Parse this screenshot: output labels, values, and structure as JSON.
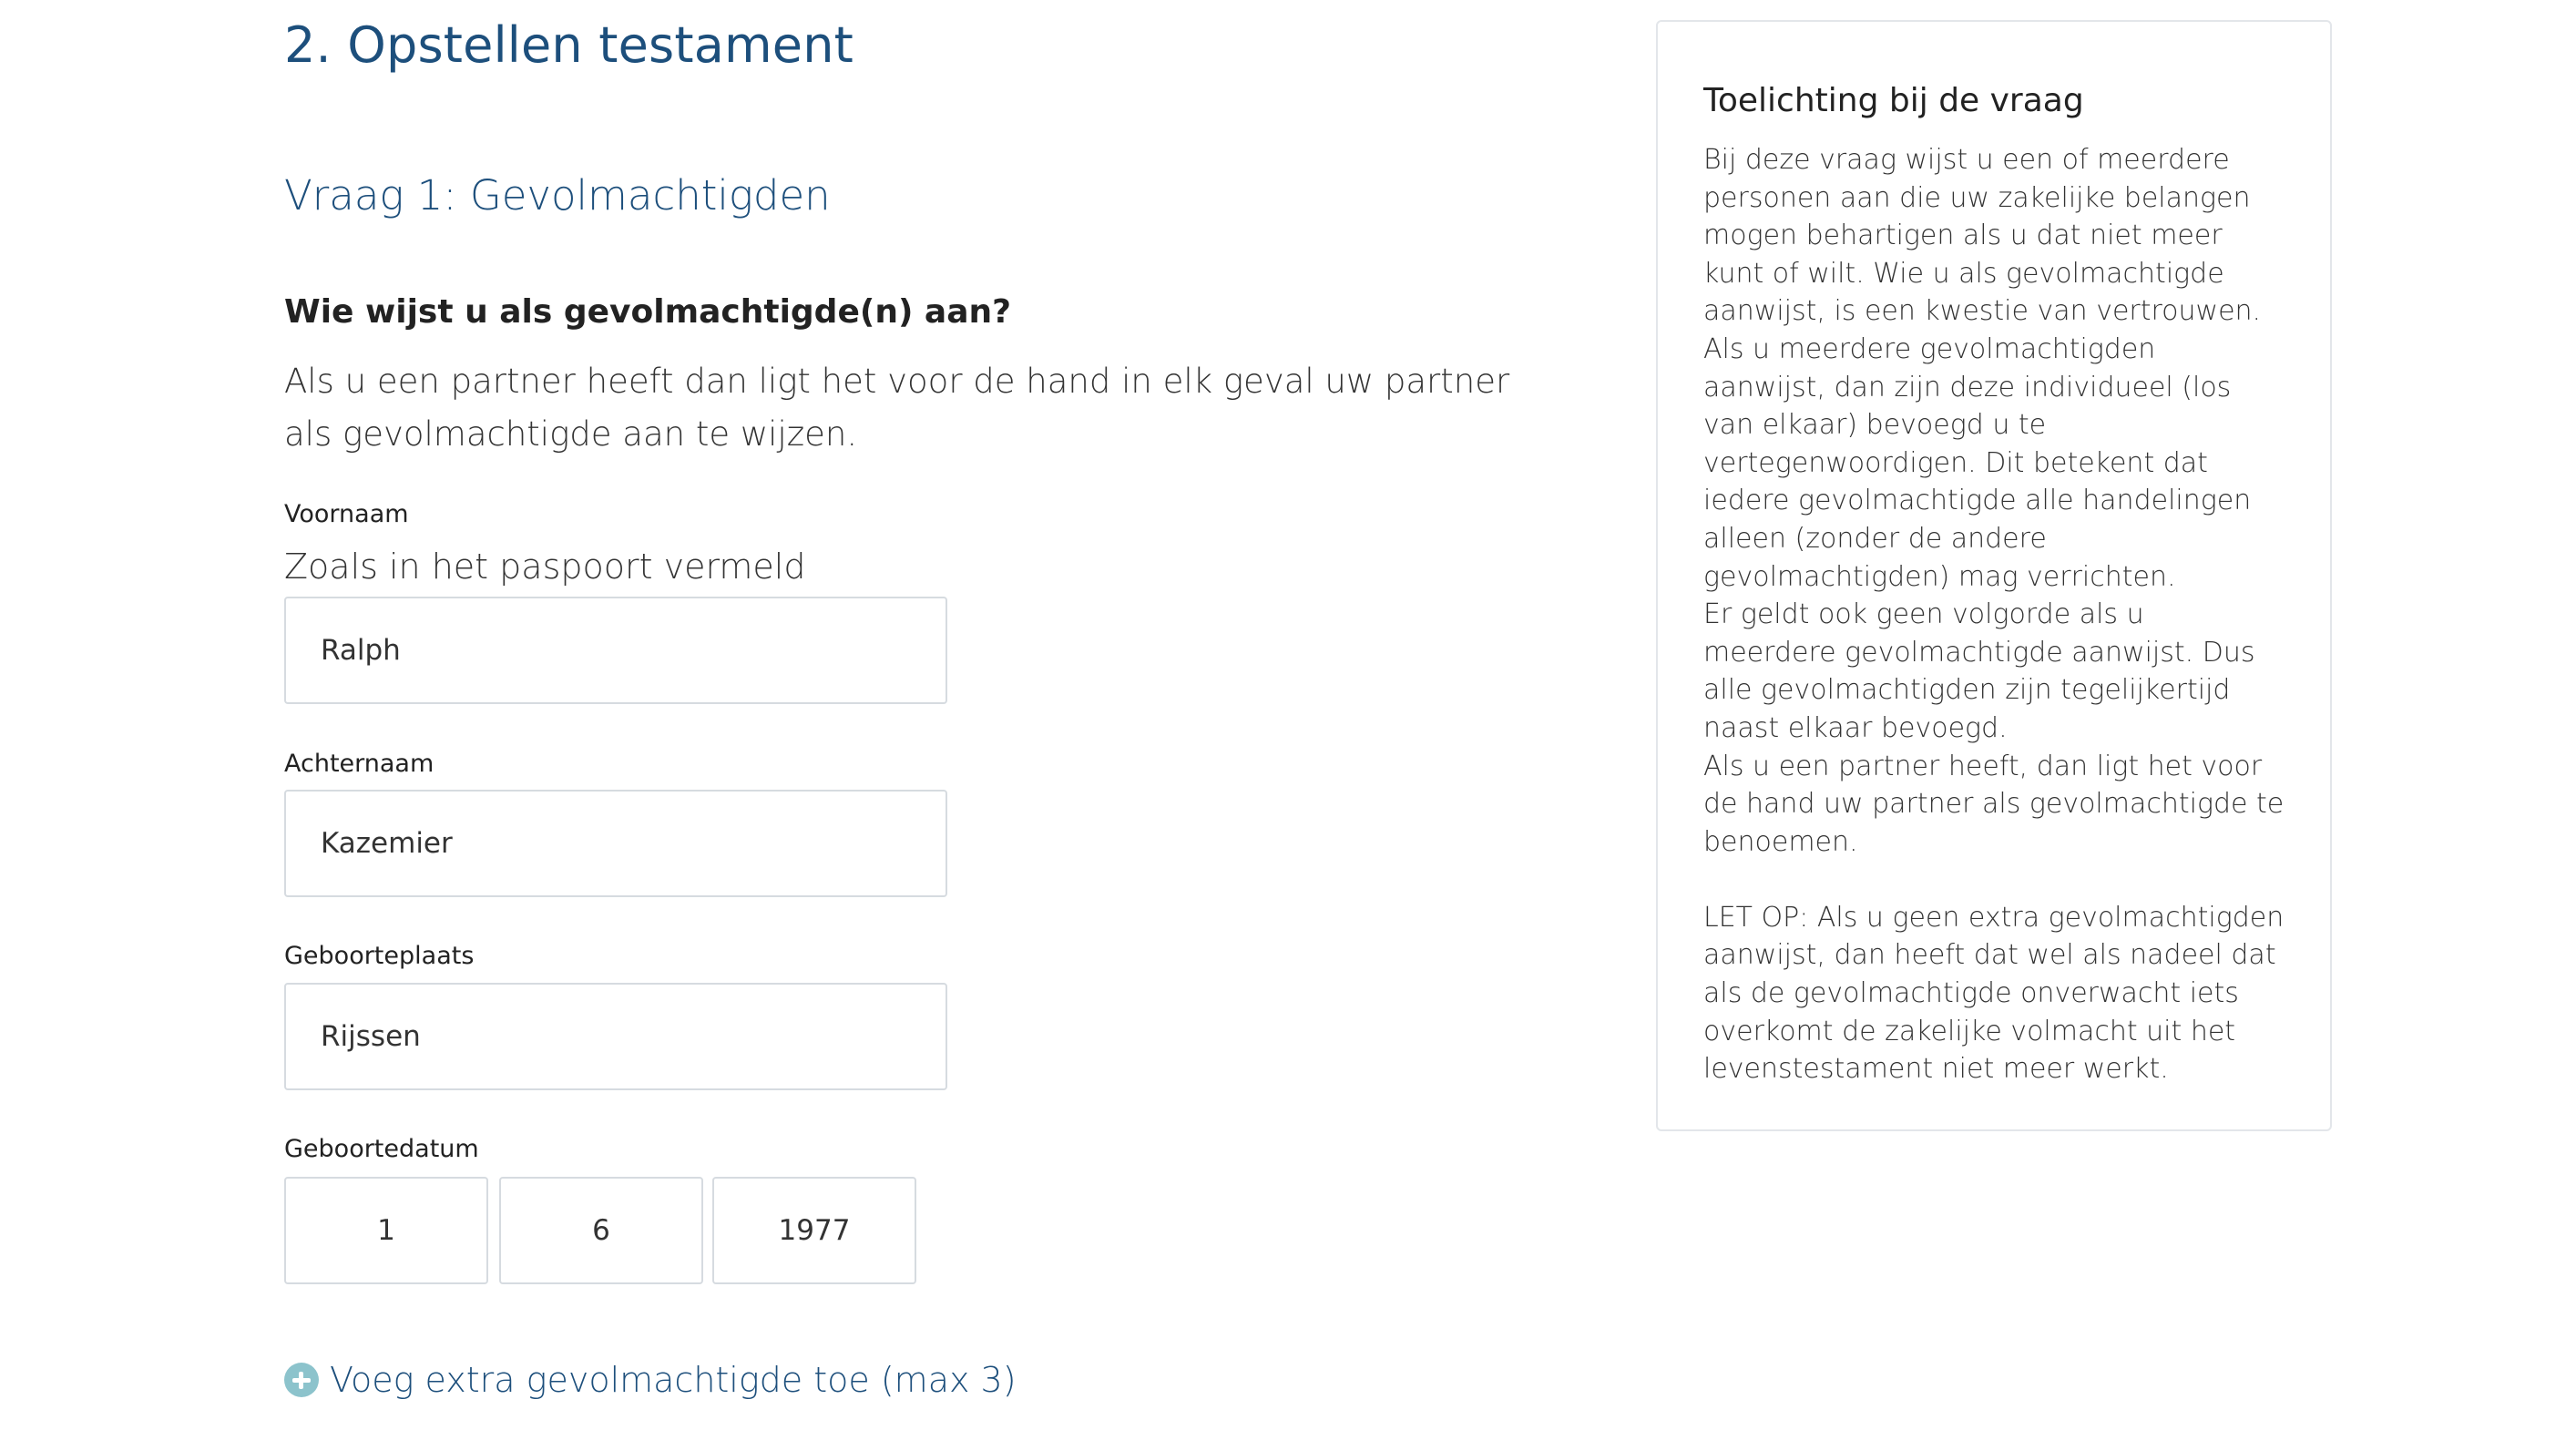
{
  "section": {
    "title": "2. Opstellen testament"
  },
  "question": {
    "title": "Vraag 1: Gevolmachtigden",
    "text": "Wie wijst u als gevolmachtigde(n) aan?",
    "hint": "Als u een partner heeft dan ligt het voor de hand in elk geval uw partner als gevolmachtigde aan te wijzen."
  },
  "form": {
    "first_name": {
      "label": "Voornaam",
      "sublabel": "Zoals in het paspoort vermeld",
      "value": "Ralph"
    },
    "last_name": {
      "label": "Achternaam",
      "value": "Kazemier"
    },
    "birthplace": {
      "label": "Geboorteplaats",
      "value": "Rijssen"
    },
    "birthdate": {
      "label": "Geboortedatum",
      "day": "1",
      "month": "6",
      "year": "1977"
    },
    "add_link": {
      "label": "Voeg extra gevolmachtigde toe (max 3)",
      "icon": "plus-circle-icon"
    }
  },
  "info": {
    "title": "Toelichting bij de vraag",
    "paragraphs": [
      "Bij deze vraag wijst u een of meerdere personen aan die uw zakelijke belangen mogen behartigen als u dat niet meer kunt of wilt. Wie u als gevolmachtigde aanwijst, is een kwestie van vertrouwen.",
      "Als u meerdere gevolmachtigden aanwijst, dan zijn deze individueel (los van elkaar) bevoegd u te vertegenwoordigen. Dit betekent dat iedere gevolmachtigde alle handelingen alleen (zonder de andere gevolmachtigden) mag verrichten.",
      "Er geldt ook geen volgorde als u meerdere gevolmachtigde aanwijst. Dus alle gevolmachtigden zijn tegelijkertijd naast elkaar bevoegd.",
      "Als u een partner heeft, dan ligt het voor de hand uw partner als gevolmachtigde te benoemen.",
      "LET OP: Als u geen extra gevolmachtigden aanwijst, dan heeft dat wel als nadeel dat als de gevolmachtigde onverwacht iets overkomt de zakelijke volmacht uit het levenstestament niet meer werkt."
    ]
  },
  "colors": {
    "heading_blue": "#1d4f7c",
    "input_border": "#d6dbe0",
    "icon_teal": "#8cc3cc"
  }
}
